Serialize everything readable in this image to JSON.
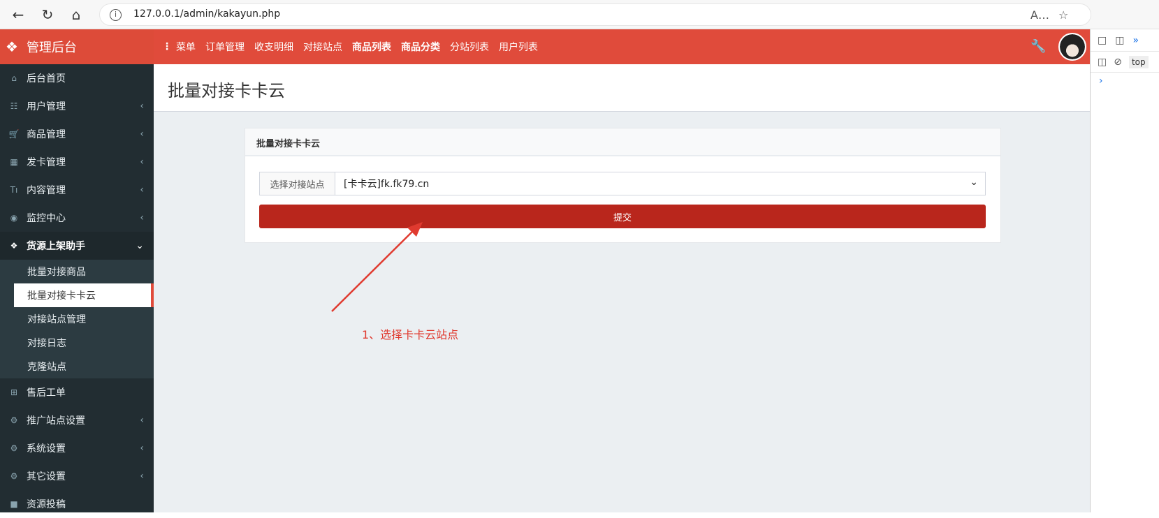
{
  "browser": {
    "url": "127.0.0.1/admin/kakayun.php",
    "back_icon": "back-arrow-icon",
    "refresh_icon": "refresh-icon",
    "home_icon": "home-icon"
  },
  "header": {
    "logo_text": "管理后台",
    "menu_label": "菜单",
    "nav_items": [
      "订单管理",
      "收支明细",
      "对接站点",
      "商品列表",
      "商品分类",
      "分站列表",
      "用户列表"
    ]
  },
  "sidebar": {
    "items": [
      {
        "label": "后台首页",
        "icon": "home-icon",
        "chevron": false
      },
      {
        "label": "用户管理",
        "icon": "sitemap-icon",
        "chevron": true
      },
      {
        "label": "商品管理",
        "icon": "cart-icon",
        "chevron": true
      },
      {
        "label": "发卡管理",
        "icon": "grid-icon",
        "chevron": true
      },
      {
        "label": "内容管理",
        "icon": "text-icon",
        "chevron": true
      },
      {
        "label": "监控中心",
        "icon": "target-icon",
        "chevron": true
      },
      {
        "label": "货源上架助手",
        "icon": "cubes-icon",
        "chevron": true,
        "open": true
      }
    ],
    "submenu": [
      {
        "label": "批量对接商品"
      },
      {
        "label": "批量对接卡卡云",
        "active": true
      },
      {
        "label": "对接站点管理"
      },
      {
        "label": "对接日志"
      },
      {
        "label": "克隆站点"
      }
    ],
    "items_after": [
      {
        "label": "售后工单",
        "icon": "plus-square-icon",
        "chevron": false
      },
      {
        "label": "推广站点设置",
        "icon": "cogs-icon",
        "chevron": true
      },
      {
        "label": "系统设置",
        "icon": "gear-icon",
        "chevron": true
      },
      {
        "label": "其它设置",
        "icon": "cogs-icon",
        "chevron": true
      },
      {
        "label": "资源投稿",
        "icon": "doc-icon",
        "chevron": false
      }
    ]
  },
  "page": {
    "title": "批量对接卡卡云",
    "panel_title": "批量对接卡卡云",
    "select_label": "选择对接站点",
    "select_value": "[卡卡云]fk.fk79.cn",
    "submit_label": "提交",
    "annotation": "1、选择卡卡云站点"
  },
  "devtools": {
    "context": "top",
    "prompt": "›"
  },
  "colors": {
    "header_red": "#e04b3b",
    "sidebar_dark": "#222d32",
    "submit_red": "#b9261c",
    "annotation_red": "#e03a2f"
  }
}
